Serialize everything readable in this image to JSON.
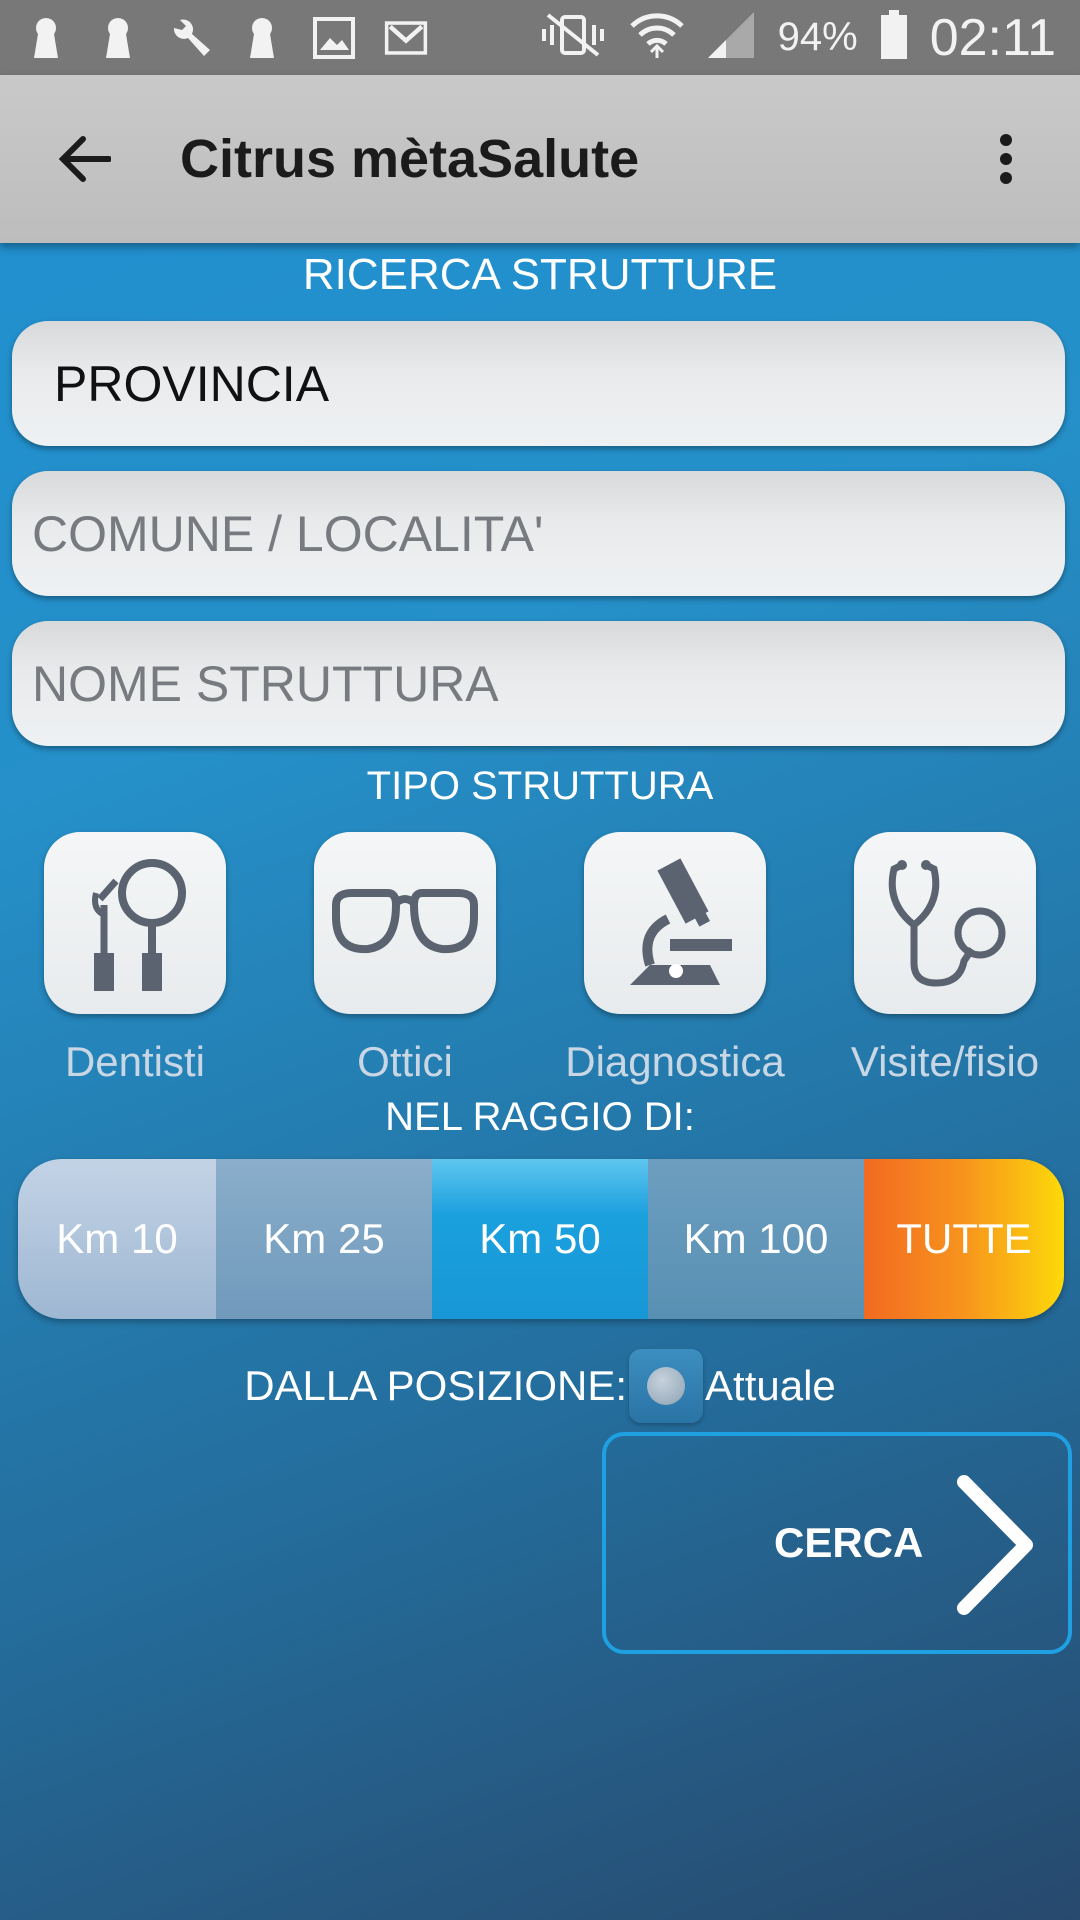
{
  "status_bar": {
    "battery": "94%",
    "time": "02:11"
  },
  "app_bar": {
    "title": "Citrus mètaSalute"
  },
  "search": {
    "heading": "RICERCA STRUTTURE",
    "provincia": "PROVINCIA",
    "comune_placeholder": "COMUNE / LOCALITA'",
    "nome_placeholder": "NOME STRUTTURA"
  },
  "types": {
    "heading": "TIPO STRUTTURA",
    "items": [
      {
        "label": "Dentisti",
        "icon": "dental-tools-icon"
      },
      {
        "label": "Ottici",
        "icon": "glasses-icon"
      },
      {
        "label": "Diagnostica",
        "icon": "microscope-icon"
      },
      {
        "label": "Visite/fisio",
        "icon": "stethoscope-icon"
      }
    ]
  },
  "radius": {
    "heading": "NEL RAGGIO DI:",
    "options": [
      "Km 10",
      "Km 25",
      "Km 50",
      "Km 100",
      "TUTTE"
    ],
    "selected": "Km 50"
  },
  "position": {
    "label": "DALLA POSIZIONE:",
    "option": "Attuale"
  },
  "action": {
    "search_label": "CERCA"
  },
  "colors": {
    "accent": "#1ea0e2",
    "app_bar": "#c4c4c4",
    "icon_gray": "#5b6370"
  }
}
